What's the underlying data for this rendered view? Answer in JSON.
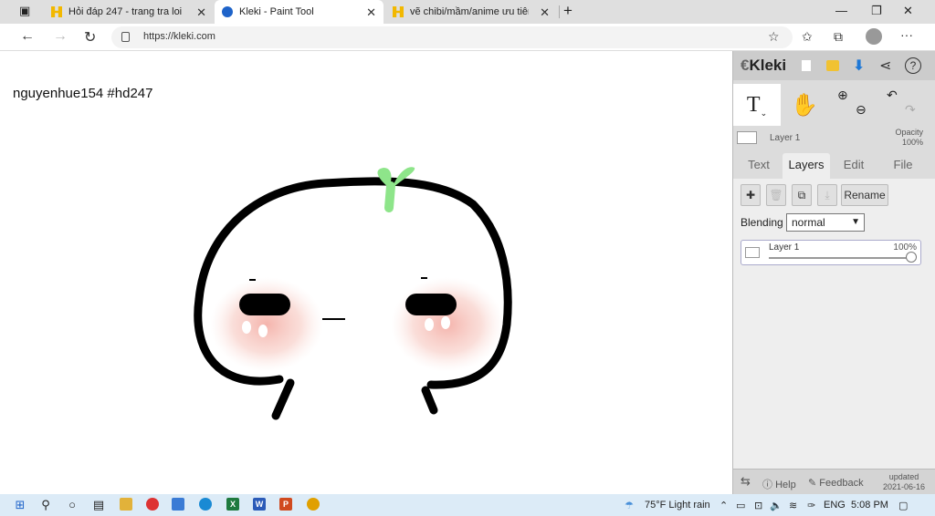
{
  "browser": {
    "tabs": [
      {
        "title": "Hỏi đáp 247 - trang tra loi",
        "active": false
      },
      {
        "title": "Kleki - Paint Tool",
        "active": true
      },
      {
        "title": "vẽ chibi/mầm/anime ưu tiên app",
        "active": false
      }
    ],
    "url": "https://kleki.com"
  },
  "canvas": {
    "signature": "nguyenhue154  #hd247"
  },
  "kleki": {
    "logo": "Kleki",
    "current_layer": "Layer 1",
    "opacity_label": "Opacity",
    "opacity_value": "100%",
    "tabs": [
      "Text",
      "Layers",
      "Edit",
      "File"
    ],
    "selected_tab": "Layers",
    "rename_label": "Rename",
    "blending_label": "Blending",
    "blending_value": "normal",
    "layers": [
      {
        "name": "Layer 1",
        "opacity": "100%"
      }
    ],
    "footer": {
      "help": "Help",
      "feedback": "Feedback",
      "updated_label": "updated",
      "updated_date": "2021-06-16"
    }
  },
  "taskbar": {
    "weather": "75°F  Light rain",
    "lang": "ENG",
    "time": "5:08 PM"
  }
}
